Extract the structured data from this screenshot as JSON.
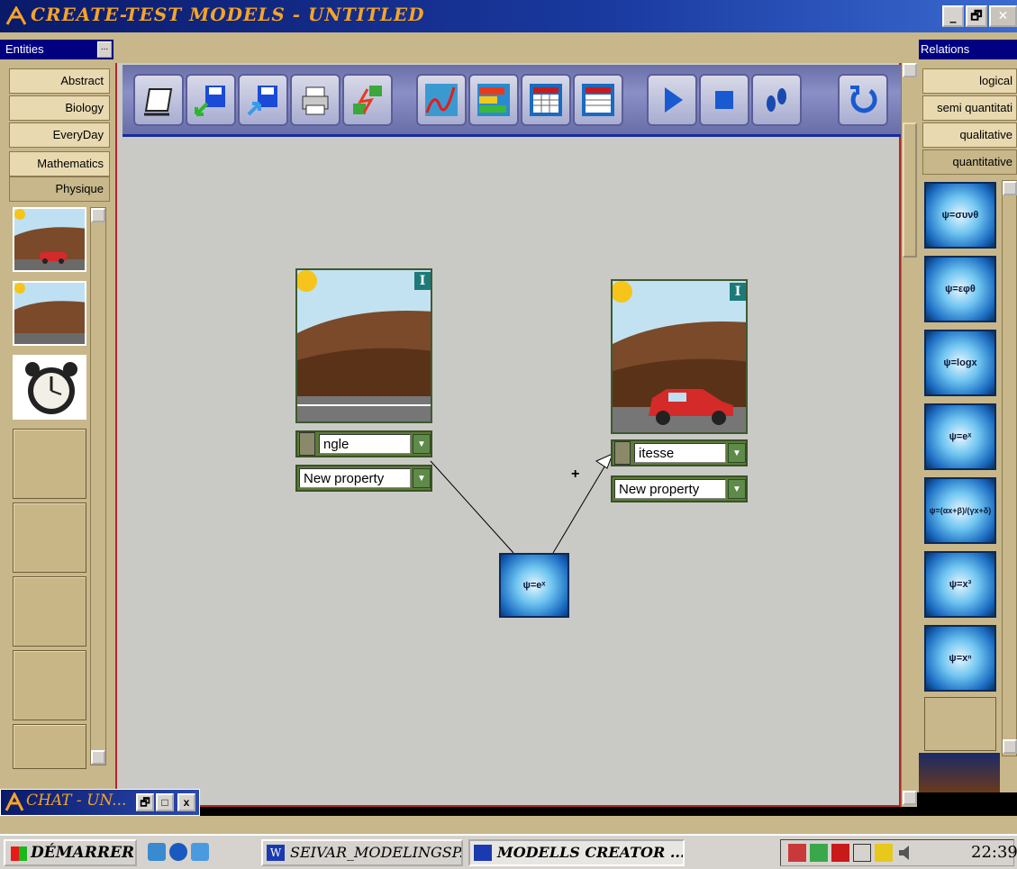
{
  "window": {
    "title": "CREATE-TEST MODELS - UNTITLED",
    "min": "_",
    "max": "🗗",
    "close": "✕"
  },
  "entities": {
    "header": "Entities",
    "menu": "...",
    "categories": [
      "Abstract",
      "Biology",
      "EveryDay",
      "Mathematics",
      "Physique"
    ]
  },
  "relations": {
    "header": "Relations",
    "tabs": [
      "logical",
      "semi quantitati",
      "qualitative",
      "quantitative"
    ],
    "items": [
      "ψ=συνθ",
      "ψ=εφθ",
      "ψ=logx",
      "ψ=eˣ",
      "ψ=(αx+β)/(γx+δ)",
      "ψ=x³",
      "ψ=xⁿ"
    ]
  },
  "toolbar": {
    "icons": [
      "new-icon",
      "save-as-icon",
      "save-icon",
      "print-icon",
      "connect-icon",
      "graph-icon",
      "bar-chart-icon",
      "table-icon",
      "sheet-icon",
      "play-icon",
      "stop-icon",
      "step-icon",
      "undo-icon"
    ]
  },
  "canvas": {
    "card1": {
      "info": "I",
      "property": "ngle",
      "new_property": "New property"
    },
    "card2": {
      "info": "I",
      "property": "itesse",
      "new_property": "New property"
    },
    "relation_node": "ψ=eˣ",
    "plus": "+"
  },
  "mini_window": {
    "title": "CHAT - UN...",
    "restore": "🗗",
    "max": "□",
    "close": "x"
  },
  "taskbar": {
    "start": "DÉMARRER",
    "tasks": [
      "SEIVAR_MODELINGSP...",
      "MODELLS CREATOR ..."
    ],
    "clock": "22:39"
  }
}
